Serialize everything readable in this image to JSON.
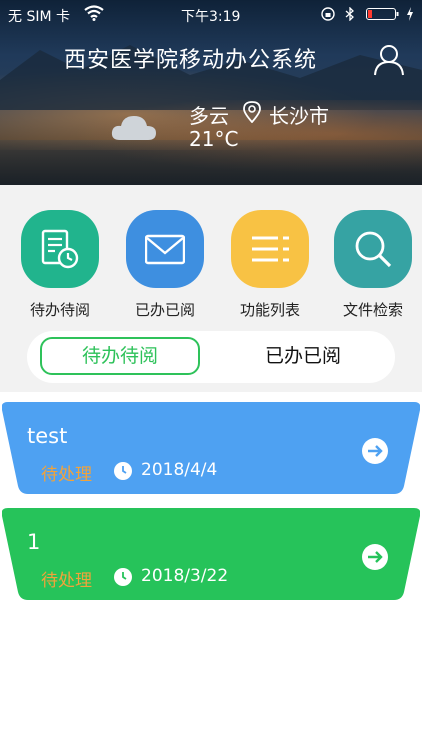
{
  "status_bar": {
    "carrier": "无 SIM 卡",
    "time": "下午3:19"
  },
  "header": {
    "title": "西安医学院移动办公系统",
    "weather": "多云",
    "city": "长沙市",
    "temperature": "21°C"
  },
  "functions": [
    {
      "label": "待办待阅",
      "color": "#21b48d",
      "icon": "document-clock-icon"
    },
    {
      "label": "已办已阅",
      "color": "#3e8fe0",
      "icon": "mail-icon"
    },
    {
      "label": "功能列表",
      "color": "#f8c244",
      "icon": "list-icon"
    },
    {
      "label": "文件检索",
      "color": "#36a3a3",
      "icon": "search-icon"
    }
  ],
  "tabs": {
    "active": "待办待阅",
    "other": "已办已阅"
  },
  "cards": [
    {
      "title": "test",
      "status": "待处理",
      "date": "2018/4/4",
      "color": "#4ea1f2"
    },
    {
      "title": "1",
      "status": "待处理",
      "date": "2018/3/22",
      "color": "#26c35a"
    }
  ]
}
